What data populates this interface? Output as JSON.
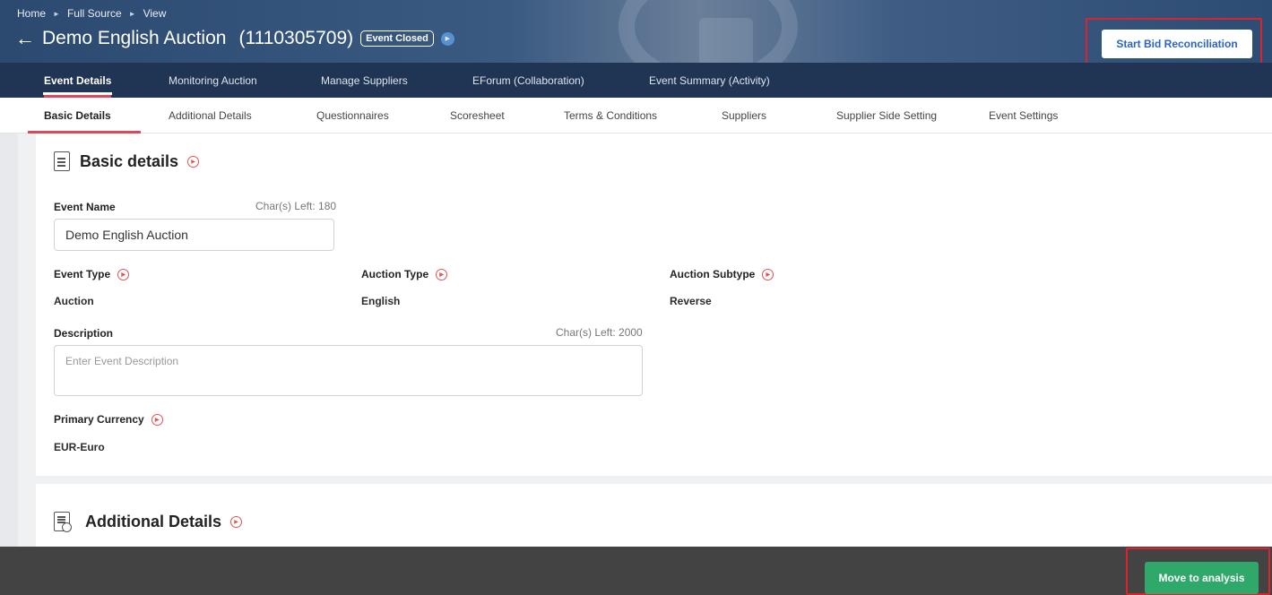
{
  "breadcrumb": [
    "Home",
    "Full Source",
    "View"
  ],
  "header": {
    "title": "Demo English Auction",
    "event_id": "(1110305709)",
    "status": "Event Closed",
    "start_bid_reconciliation": "Start Bid Reconciliation"
  },
  "primary_tabs": [
    {
      "label": "Event Details",
      "active": true
    },
    {
      "label": "Monitoring Auction"
    },
    {
      "label": "Manage Suppliers"
    },
    {
      "label": "EForum (Collaboration)"
    },
    {
      "label": "Event Summary (Activity)"
    }
  ],
  "secondary_tabs": [
    {
      "label": "Basic Details",
      "active": true
    },
    {
      "label": "Additional Details"
    },
    {
      "label": "Questionnaires"
    },
    {
      "label": "Scoresheet"
    },
    {
      "label": "Terms & Conditions"
    },
    {
      "label": "Suppliers"
    },
    {
      "label": "Supplier Side Setting"
    },
    {
      "label": "Event Settings"
    }
  ],
  "basic_details": {
    "section_title": "Basic details",
    "event_name_label": "Event Name",
    "event_name_chars_left": "Char(s) Left: 180",
    "event_name_value": "Demo English Auction",
    "event_type_label": "Event Type",
    "event_type_value": "Auction",
    "auction_type_label": "Auction Type",
    "auction_type_value": "English",
    "auction_subtype_label": "Auction Subtype",
    "auction_subtype_value": "Reverse",
    "description_label": "Description",
    "description_chars_left": "Char(s) Left: 2000",
    "description_placeholder": "Enter Event Description",
    "primary_currency_label": "Primary Currency",
    "primary_currency_value": "EUR-Euro"
  },
  "additional_details": {
    "section_title": "Additional Details"
  },
  "footer": {
    "move_to_analysis": "Move to analysis"
  },
  "colors": {
    "nav_bg": "#1f3553",
    "accent_red": "#d94a5a",
    "primary_blue": "#2a64c8",
    "success_green": "#2fa86a",
    "footer_bg": "#434343"
  }
}
